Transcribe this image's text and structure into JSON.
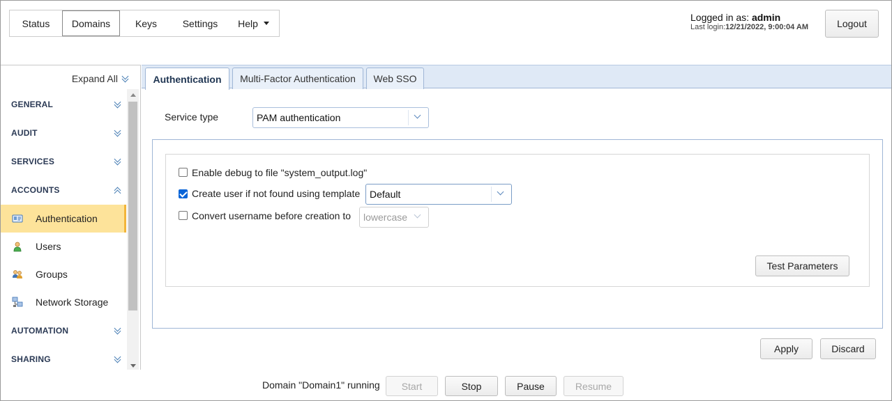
{
  "nav": {
    "items": [
      {
        "label": "Status",
        "active": false
      },
      {
        "label": "Domains",
        "active": true
      },
      {
        "label": "Keys",
        "active": false
      },
      {
        "label": "Settings",
        "active": false
      },
      {
        "label": "Help",
        "active": false
      }
    ]
  },
  "session": {
    "logged_in_prefix": "Logged in as:",
    "user": "admin",
    "last_login_prefix": "Last login:",
    "last_login": "12/21/2022, 9:00:04 AM",
    "logout_label": "Logout"
  },
  "sidebar": {
    "expand_all": "Expand All",
    "sections": {
      "general": "GENERAL",
      "audit": "AUDIT",
      "services": "SERVICES",
      "accounts": "ACCOUNTS",
      "automation": "AUTOMATION",
      "sharing": "SHARING"
    },
    "items": [
      {
        "label": "Authentication",
        "icon": "id-card-icon",
        "active": true
      },
      {
        "label": "Users",
        "icon": "user-icon"
      },
      {
        "label": "Groups",
        "icon": "group-icon"
      },
      {
        "label": "Network Storage",
        "icon": "network-storage-icon"
      }
    ]
  },
  "tabs": [
    {
      "label": "Authentication",
      "active": true
    },
    {
      "label": "Multi-Factor Authentication",
      "active": false
    },
    {
      "label": "Web SSO",
      "active": false
    }
  ],
  "form": {
    "service_type_label": "Service type",
    "service_type_value": "PAM authentication",
    "debug_label": "Enable debug to file \"system_output.log\"",
    "debug_checked": false,
    "create_user_label": "Create user if not found using template",
    "create_user_checked": true,
    "template_value": "Default",
    "convert_label": "Convert username before creation to",
    "convert_checked": false,
    "convert_value": "lowercase",
    "test_button": "Test Parameters",
    "apply_button": "Apply",
    "discard_button": "Discard"
  },
  "footer": {
    "status_text": "Domain \"Domain1\" running",
    "start": "Start",
    "stop": "Stop",
    "pause": "Pause",
    "resume": "Resume"
  },
  "colors": {
    "active_sidebar_bg": "#fde39a",
    "tabbar_bg": "#dfe9f6",
    "checkbox_on": "#0a65d8"
  }
}
